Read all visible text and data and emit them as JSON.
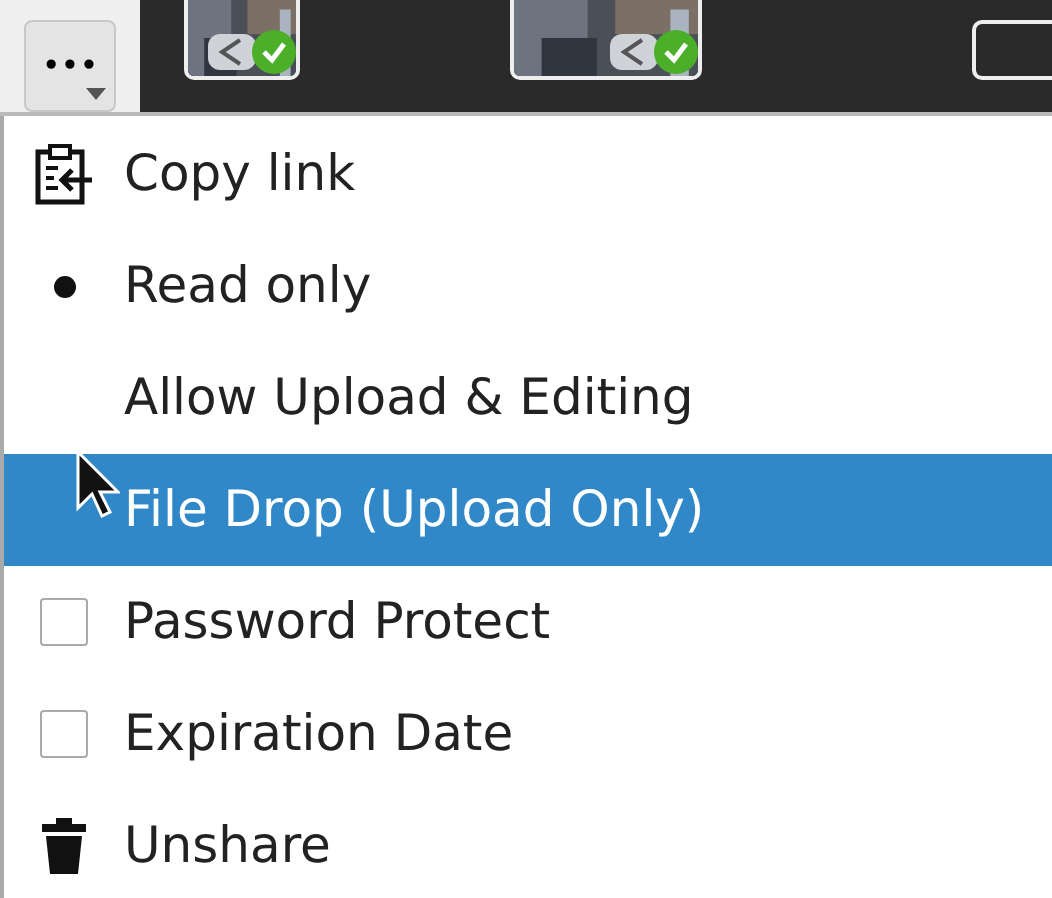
{
  "toolbar": {
    "more_button": {
      "label": "•••"
    },
    "thumbnails": [
      {
        "kind": "picture",
        "shared": true,
        "synced": true
      },
      {
        "kind": "picture",
        "shared": true,
        "synced": true
      }
    ]
  },
  "menu": {
    "items": [
      {
        "kind": "copy",
        "label": "Copy link",
        "highlighted": false
      },
      {
        "kind": "radio",
        "label": "Read only",
        "selected": true,
        "highlighted": false
      },
      {
        "kind": "radio",
        "label": "Allow Upload & Editing",
        "selected": false,
        "highlighted": false
      },
      {
        "kind": "radio",
        "label": "File Drop (Upload Only)",
        "selected": false,
        "highlighted": true
      },
      {
        "kind": "checkbox",
        "label": "Password Protect",
        "checked": false,
        "highlighted": false
      },
      {
        "kind": "checkbox",
        "label": "Expiration Date",
        "checked": false,
        "highlighted": false
      },
      {
        "kind": "remove",
        "label": "Unshare",
        "highlighted": false
      }
    ]
  }
}
